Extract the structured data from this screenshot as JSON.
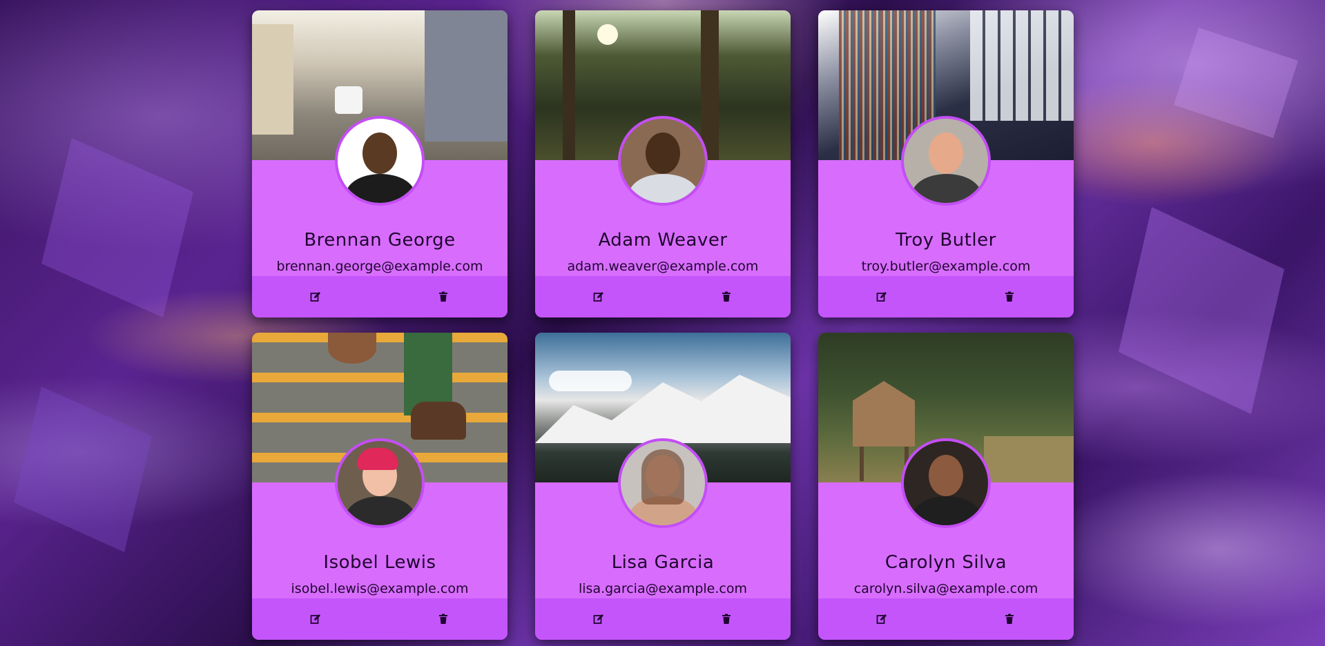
{
  "colors": {
    "card_body": "#d86dfd",
    "card_actions": "#c455fb",
    "avatar_border": "#c44ef5",
    "text": "#1f0530"
  },
  "cards": [
    {
      "name": "Brennan George",
      "email": "brennan.george@example.com",
      "cover": "city-street-photo",
      "edit_icon": "edit-icon",
      "delete_icon": "trash-icon"
    },
    {
      "name": "Adam Weaver",
      "email": "adam.weaver@example.com",
      "cover": "forest-photo",
      "edit_icon": "edit-icon",
      "delete_icon": "trash-icon"
    },
    {
      "name": "Troy Butler",
      "email": "troy.butler@example.com",
      "cover": "library-photo",
      "edit_icon": "edit-icon",
      "delete_icon": "trash-icon"
    },
    {
      "name": "Isobel Lewis",
      "email": "isobel.lewis@example.com",
      "cover": "stairs-photo",
      "edit_icon": "edit-icon",
      "delete_icon": "trash-icon"
    },
    {
      "name": "Lisa Garcia",
      "email": "lisa.garcia@example.com",
      "cover": "mountain-photo",
      "edit_icon": "edit-icon",
      "delete_icon": "trash-icon"
    },
    {
      "name": "Carolyn Silva",
      "email": "carolyn.silva@example.com",
      "cover": "cabin-photo",
      "edit_icon": "edit-icon",
      "delete_icon": "trash-icon"
    }
  ]
}
